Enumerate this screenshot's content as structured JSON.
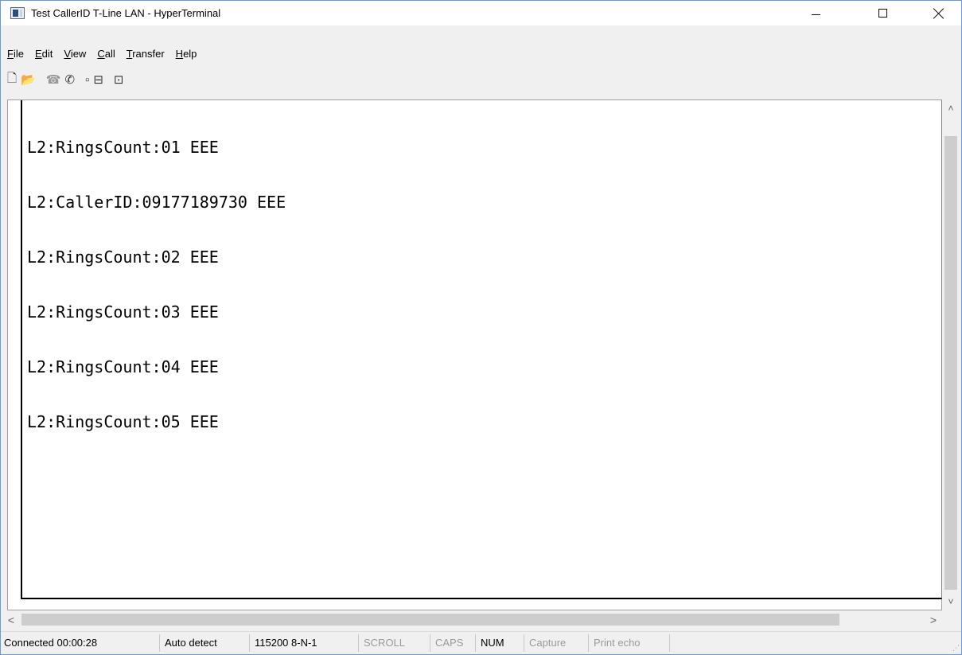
{
  "window": {
    "title": "Test CallerID T-Line LAN - HyperTerminal",
    "controls": {
      "minimize_icon": "minimize-icon",
      "maximize_icon": "maximize-icon",
      "close_icon": "close-icon"
    }
  },
  "menu": {
    "items": [
      {
        "label": "File",
        "accel": "F"
      },
      {
        "label": "Edit",
        "accel": "E"
      },
      {
        "label": "View",
        "accel": "V"
      },
      {
        "label": "Call",
        "accel": "C"
      },
      {
        "label": "Transfer",
        "accel": "T"
      },
      {
        "label": "Help",
        "accel": "H"
      }
    ]
  },
  "toolbar": {
    "buttons": [
      {
        "name": "new-connection",
        "icon": "new-document-icon",
        "glyph": "🗋"
      },
      {
        "name": "open",
        "icon": "open-folder-icon",
        "glyph": "📂"
      },
      {
        "name": "call",
        "icon": "phone-icon",
        "glyph": "☎"
      },
      {
        "name": "disconnect",
        "icon": "disconnect-icon",
        "glyph": "✆"
      },
      {
        "name": "send",
        "icon": "send-icon",
        "glyph": "▫"
      },
      {
        "name": "receive",
        "icon": "receive-icon",
        "glyph": "⊟"
      },
      {
        "name": "properties",
        "icon": "properties-icon",
        "glyph": "⊡"
      }
    ]
  },
  "terminal": {
    "lines": [
      "L2:RingsCount:01 EEE",
      "L2:CallerID:09177189730 EEE",
      "L2:RingsCount:02 EEE",
      "L2:RingsCount:03 EEE",
      "L2:RingsCount:04 EEE",
      "L2:RingsCount:05 EEE"
    ]
  },
  "statusbar": {
    "connected": "Connected 00:00:28",
    "detect": "Auto detect",
    "settings": "115200 8-N-1",
    "scroll": "SCROLL",
    "caps": "CAPS",
    "num": "NUM",
    "capture": "Capture",
    "print_echo": "Print echo"
  }
}
